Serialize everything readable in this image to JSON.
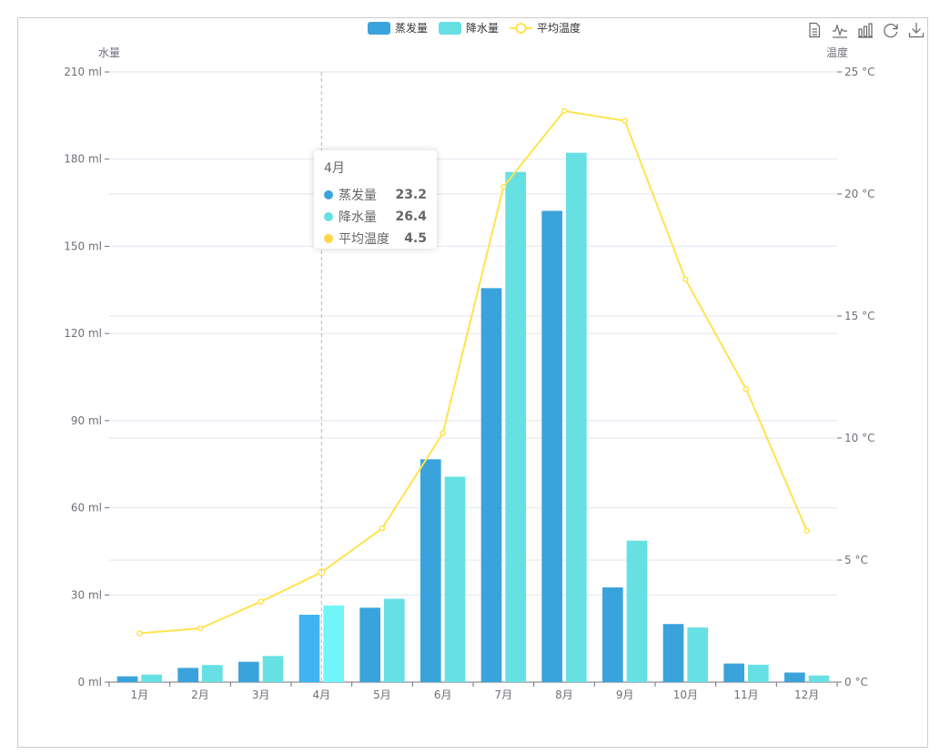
{
  "chart_data": {
    "type": "bar",
    "categories": [
      "1月",
      "2月",
      "3月",
      "4月",
      "5月",
      "6月",
      "7月",
      "8月",
      "9月",
      "10月",
      "11月",
      "12月"
    ],
    "series": [
      {
        "name": "蒸发量",
        "type": "bar",
        "axis": "left",
        "color": "#3ba3db",
        "values": [
          2.0,
          4.9,
          7.0,
          23.2,
          25.6,
          76.7,
          135.6,
          162.2,
          32.6,
          20.0,
          6.4,
          3.3
        ]
      },
      {
        "name": "降水量",
        "type": "bar",
        "axis": "left",
        "color": "#66e0e3",
        "values": [
          2.6,
          5.9,
          9.0,
          26.4,
          28.7,
          70.7,
          175.6,
          182.2,
          48.7,
          18.8,
          6.0,
          2.3
        ]
      },
      {
        "name": "平均温度",
        "type": "line",
        "axis": "right",
        "color": "#ffe34e",
        "values": [
          2.0,
          2.2,
          3.3,
          4.5,
          6.3,
          10.2,
          20.3,
          23.4,
          23.0,
          16.5,
          12.0,
          6.2
        ]
      }
    ],
    "y_left": {
      "label": "水量",
      "ylim": [
        0,
        210
      ],
      "ticks": [
        "0 ml",
        "30 ml",
        "60 ml",
        "90 ml",
        "120 ml",
        "150 ml",
        "180 ml",
        "210 ml"
      ]
    },
    "y_right": {
      "label": "温度",
      "ylim": [
        0,
        25
      ],
      "ticks": [
        "0 °C",
        "5 °C",
        "10 °C",
        "15 °C",
        "20 °C",
        "25 °C"
      ]
    },
    "grid": true,
    "legend": "top-center",
    "highlighted_category": "4月",
    "highlight_colors": [
      "#40b3f0",
      "#70f6f9"
    ]
  },
  "legend": [
    {
      "label": "蒸发量",
      "color": "#3ba3db",
      "kind": "bar"
    },
    {
      "label": "降水量",
      "color": "#66e0e3",
      "kind": "bar"
    },
    {
      "label": "平均温度",
      "color": "#ffe34e",
      "kind": "line"
    }
  ],
  "toolbox": [
    "data-view-icon",
    "line-chart-icon",
    "bar-chart-icon",
    "restore-icon",
    "save-image-icon"
  ],
  "tooltip": {
    "title": "4月",
    "rows": [
      {
        "name": "蒸发量",
        "value": "23.2",
        "color": "#3ba3db"
      },
      {
        "name": "降水量",
        "value": "26.4",
        "color": "#66e0e3"
      },
      {
        "name": "平均温度",
        "value": "4.5",
        "color": "#ffd54a"
      }
    ]
  }
}
